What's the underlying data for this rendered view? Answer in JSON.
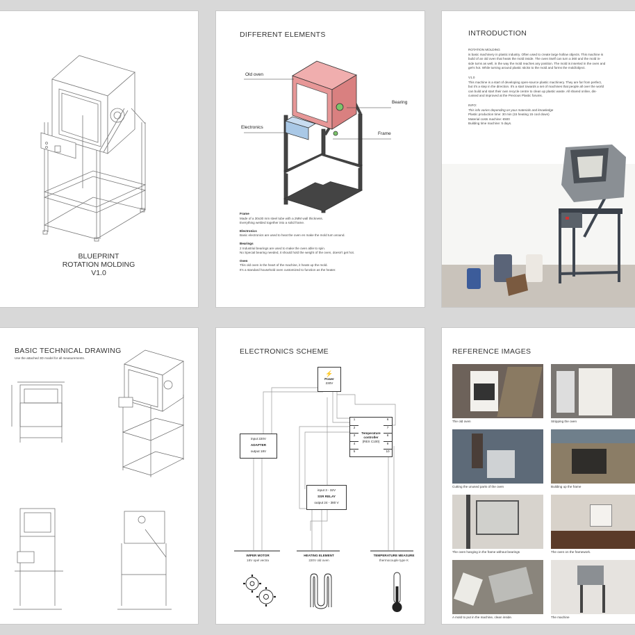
{
  "page1": {
    "title_lines": [
      "BLUEPRINT",
      "ROTATION MOLDING",
      "V1.0"
    ]
  },
  "page2": {
    "title": "DIFFERENT ELEMENTS",
    "callouts": {
      "oven": "Old oven",
      "bearing": "Bearing",
      "electronics": "Electronics",
      "frame": "Frame"
    },
    "sections": [
      {
        "heading": "Frame",
        "lines": [
          "Made of a 30x30 mm steel tube with a 2MM wall thickness.",
          "Everything welded together into a solid frame."
        ]
      },
      {
        "heading": "Electronics",
        "lines": [
          "Basic electronics are used to heat the oven en make the mold turn around."
        ]
      },
      {
        "heading": "Bearings",
        "lines": [
          "2 Industrial bearings are used to make the oven able to spin.",
          "No Special bearing needed, it should hold the weight of the oven, doesn't get hot."
        ]
      },
      {
        "heading": "Oven",
        "lines": [
          "This old oven is the heart of the machine, it heats up the mold.",
          "It's a standard household oven customized to function as the heater."
        ]
      }
    ]
  },
  "page3": {
    "title": "INTRODUCTION",
    "blocks": [
      {
        "heading": "ROTATION MOLDING",
        "lines": [
          "is basic machinery in plastic industry. Often used to create large hollow objects. This machine is",
          "build of an old oven that heats the mold inside. The oven itself can turn a 360 and the mold in-",
          "side turns as well, in the way the mold reaches any position. The mold is inserted in the oven and",
          "get's hot. While turning around plastic sticks to the mold and forms the mold/object."
        ]
      },
      {
        "heading": "V1.0",
        "lines": [
          "This machine is a start of developing open-source plastic machinery. They are far from perfect,",
          "but it's a step in the direction. It's a start towards a set of machines that people all over the world",
          "can build and start their own recycle centre to clean up plastic waste. All shared online, dis-",
          "cussed and improved at the Precious Plastic forums."
        ]
      },
      {
        "heading": "INFO:",
        "lines": [
          "This info varies depending on your materials and knowledge",
          "Plastic production time: 30 min (15 heating 15 cool down)",
          "Material costs machine: €500",
          "Building time machine: 5 days."
        ]
      }
    ]
  },
  "page4": {
    "title": "BASIC TECHNICAL DRAWING",
    "subtitle": "Use the attached 3D model for all measurements."
  },
  "page5": {
    "title": "ELECTRONICS SCHEME",
    "power": {
      "label": "Power",
      "value": "230V"
    },
    "adapter": {
      "input": "input 220V",
      "name": "ADAPTER",
      "output": "output 18V"
    },
    "controller": {
      "name": "Temperature controller",
      "model": "(REX C100)",
      "left_pins": [
        "1",
        "2",
        "3",
        "4",
        "5"
      ],
      "right_pins": [
        "6",
        "7",
        "8",
        "9",
        "10"
      ]
    },
    "relay": {
      "input": "input 3 - 32V",
      "name": "SSR RELAY",
      "output": "output 24 - 380 V"
    },
    "outputs": [
      {
        "name": "WIPER MOTOR",
        "sub": "18V opel vectra"
      },
      {
        "name": "HEATING ELEMENT",
        "sub": "220V old oven"
      },
      {
        "name": "TEMPERATURE MEASURE",
        "sub": "thermocouple type K"
      }
    ],
    "icons": [
      "gears-icon",
      "heating-coil-icon",
      "thermometer-icon"
    ]
  },
  "page6": {
    "title": "REFERENCE IMAGES",
    "captions": [
      "The old oven",
      "Stripping the oven",
      "Cutting the unused parts of the oven",
      "Building up the frame",
      "The oven hanging in the frame without bearings",
      "The oven on the framework.",
      "A mold to put in the machine, clean inside.",
      "The machine"
    ]
  }
}
